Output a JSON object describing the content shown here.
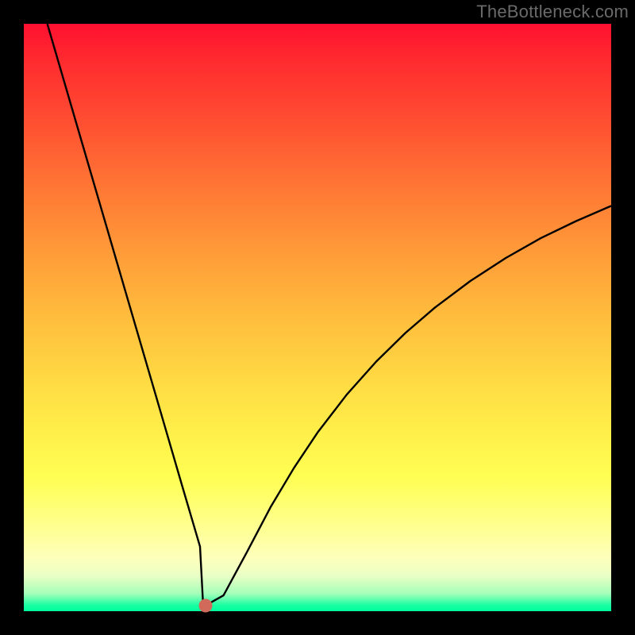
{
  "watermark": "TheBottleneck.com",
  "chart_data": {
    "type": "line",
    "title": "",
    "xlabel": "",
    "ylabel": "",
    "xlim": [
      0,
      100
    ],
    "ylim": [
      0,
      100
    ],
    "series": [
      {
        "name": "curve",
        "x": [
          4,
          8,
          12,
          16,
          20,
          24,
          27,
          29,
          30,
          30.5,
          31,
          34,
          38,
          42,
          46,
          50,
          55,
          60,
          65,
          70,
          76,
          82,
          88,
          94,
          100
        ],
        "y": [
          100,
          86.3,
          72.6,
          58.9,
          45.2,
          31.5,
          21.2,
          14.4,
          11.0,
          1.6,
          1.0,
          2.7,
          10.1,
          17.7,
          24.4,
          30.4,
          36.9,
          42.5,
          47.4,
          51.7,
          56.2,
          60.1,
          63.5,
          66.4,
          69.0
        ]
      }
    ],
    "marker": {
      "x": 30.9,
      "y": 1.0,
      "color": "#d16a5a"
    },
    "background": {
      "gradient_stops": [
        {
          "pos": 0,
          "color": "#ff1030"
        },
        {
          "pos": 50,
          "color": "#ffc83f"
        },
        {
          "pos": 80,
          "color": "#ffff66"
        },
        {
          "pos": 100,
          "color": "#00ff9f"
        }
      ]
    }
  }
}
